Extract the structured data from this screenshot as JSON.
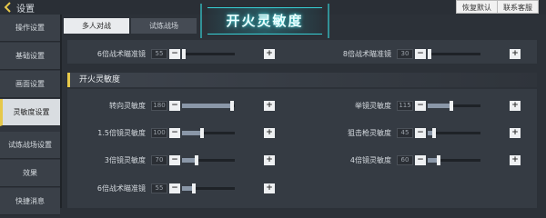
{
  "header": {
    "title": "设置",
    "restore_default": "恢复默认",
    "contact_support": "联系客服"
  },
  "sidebar": {
    "items": [
      {
        "label": "操作设置",
        "active": false
      },
      {
        "label": "基础设置",
        "active": false
      },
      {
        "label": "画面设置",
        "active": false
      },
      {
        "label": "灵敏度设置",
        "active": true
      },
      {
        "label": "试炼战场设置",
        "active": false
      },
      {
        "label": "效果",
        "active": false
      },
      {
        "label": "快捷消息",
        "active": false
      }
    ]
  },
  "tabs": [
    {
      "label": "多人对战",
      "active": true
    },
    {
      "label": "试炼战场",
      "active": false
    }
  ],
  "banner": {
    "text": "开火灵敏度"
  },
  "top_row": [
    {
      "label": "6倍战术瞄准镜",
      "value": "55",
      "fraction": 0.0
    },
    {
      "label": "8倍战术瞄准镜",
      "value": "30",
      "fraction": 0.0
    }
  ],
  "section": {
    "title": "开火灵敏度"
  },
  "settings_left": [
    {
      "label": "转向灵敏度",
      "value": "180",
      "fraction": 0.95
    },
    {
      "label": "1.5倍镜灵敏度",
      "value": "100",
      "fraction": 0.38
    },
    {
      "label": "3倍镜灵敏度",
      "value": "70",
      "fraction": 0.28
    },
    {
      "label": "6倍战术瞄准镜",
      "value": "55",
      "fraction": 0.22
    }
  ],
  "settings_right": [
    {
      "label": "举镜灵敏度",
      "value": "115",
      "fraction": 0.44
    },
    {
      "label": "狙击枪灵敏度",
      "value": "45",
      "fraction": 0.12
    },
    {
      "label": "4倍镜灵敏度",
      "value": "60",
      "fraction": 0.2
    }
  ],
  "controls": {
    "minus": "−",
    "plus": "+"
  }
}
